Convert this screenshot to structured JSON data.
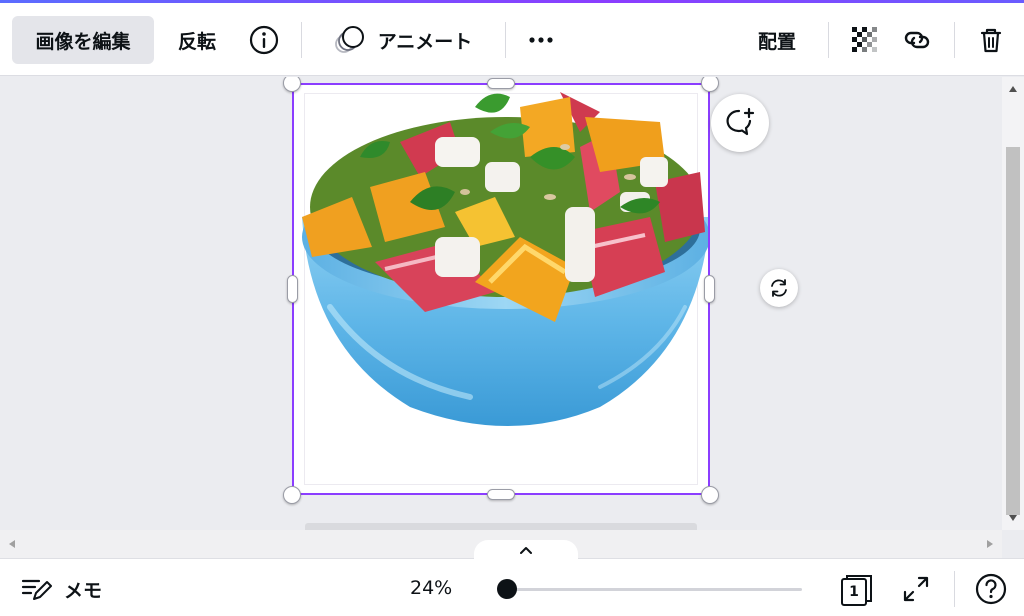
{
  "toolbar": {
    "edit_image": "画像を編集",
    "flip": "反転",
    "animate": "アニメート",
    "position": "配置"
  },
  "bottom_bar": {
    "notes": "メモ",
    "zoom_percent": "24%",
    "page_number": "1"
  },
  "zoom": {
    "level_fraction": 0.0
  },
  "colors": {
    "accent": "#8b3dff",
    "toolbar_bg": "#ffffff",
    "canvas_bg": "#ebecf0",
    "active_button_bg": "#e4e5ea"
  },
  "icons": [
    "info-icon",
    "animate-circles-icon",
    "more-icon",
    "transparency-icon",
    "link-icon",
    "trash-icon",
    "comment-plus-icon",
    "rotate-icon",
    "notes-icon",
    "page-count-icon",
    "fullscreen-icon",
    "help-icon"
  ]
}
